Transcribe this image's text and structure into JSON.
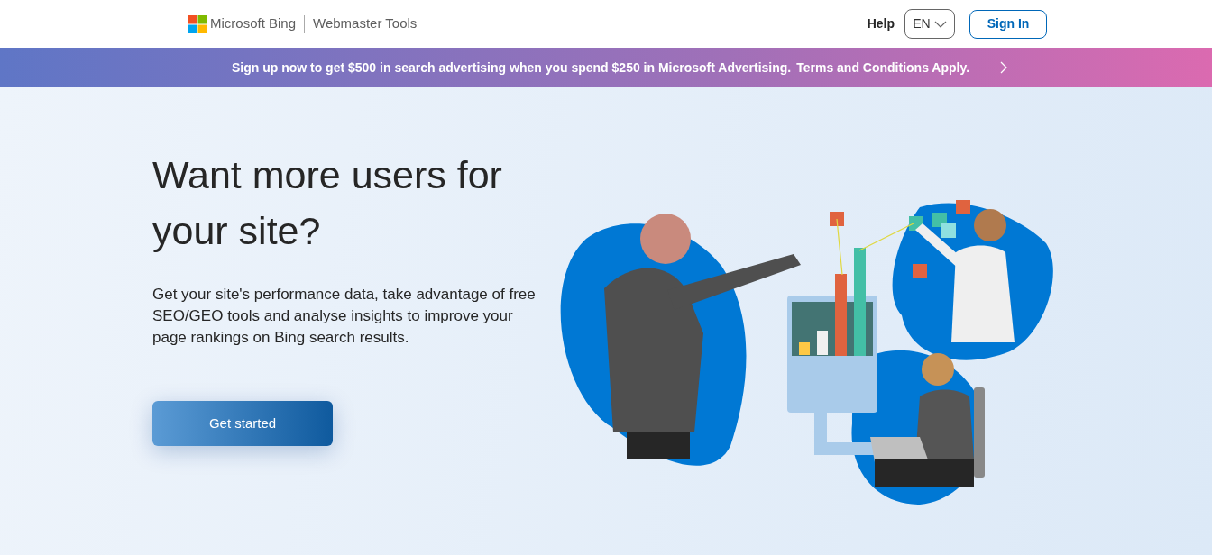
{
  "header": {
    "brand": "Microsoft Bing",
    "product": "Webmaster Tools",
    "help": "Help",
    "language": "EN",
    "sign_in": "Sign In"
  },
  "banner": {
    "text": "Sign up now to get $500 in search advertising when you spend $250 in Microsoft Advertising.",
    "link": "Terms and Conditions Apply."
  },
  "hero": {
    "heading": "Want more users for your site?",
    "description": "Get your site's performance data, take advantage of free SEO/GEO tools and analyse insights to improve your page rankings on Bing search results.",
    "button": "Get started"
  }
}
